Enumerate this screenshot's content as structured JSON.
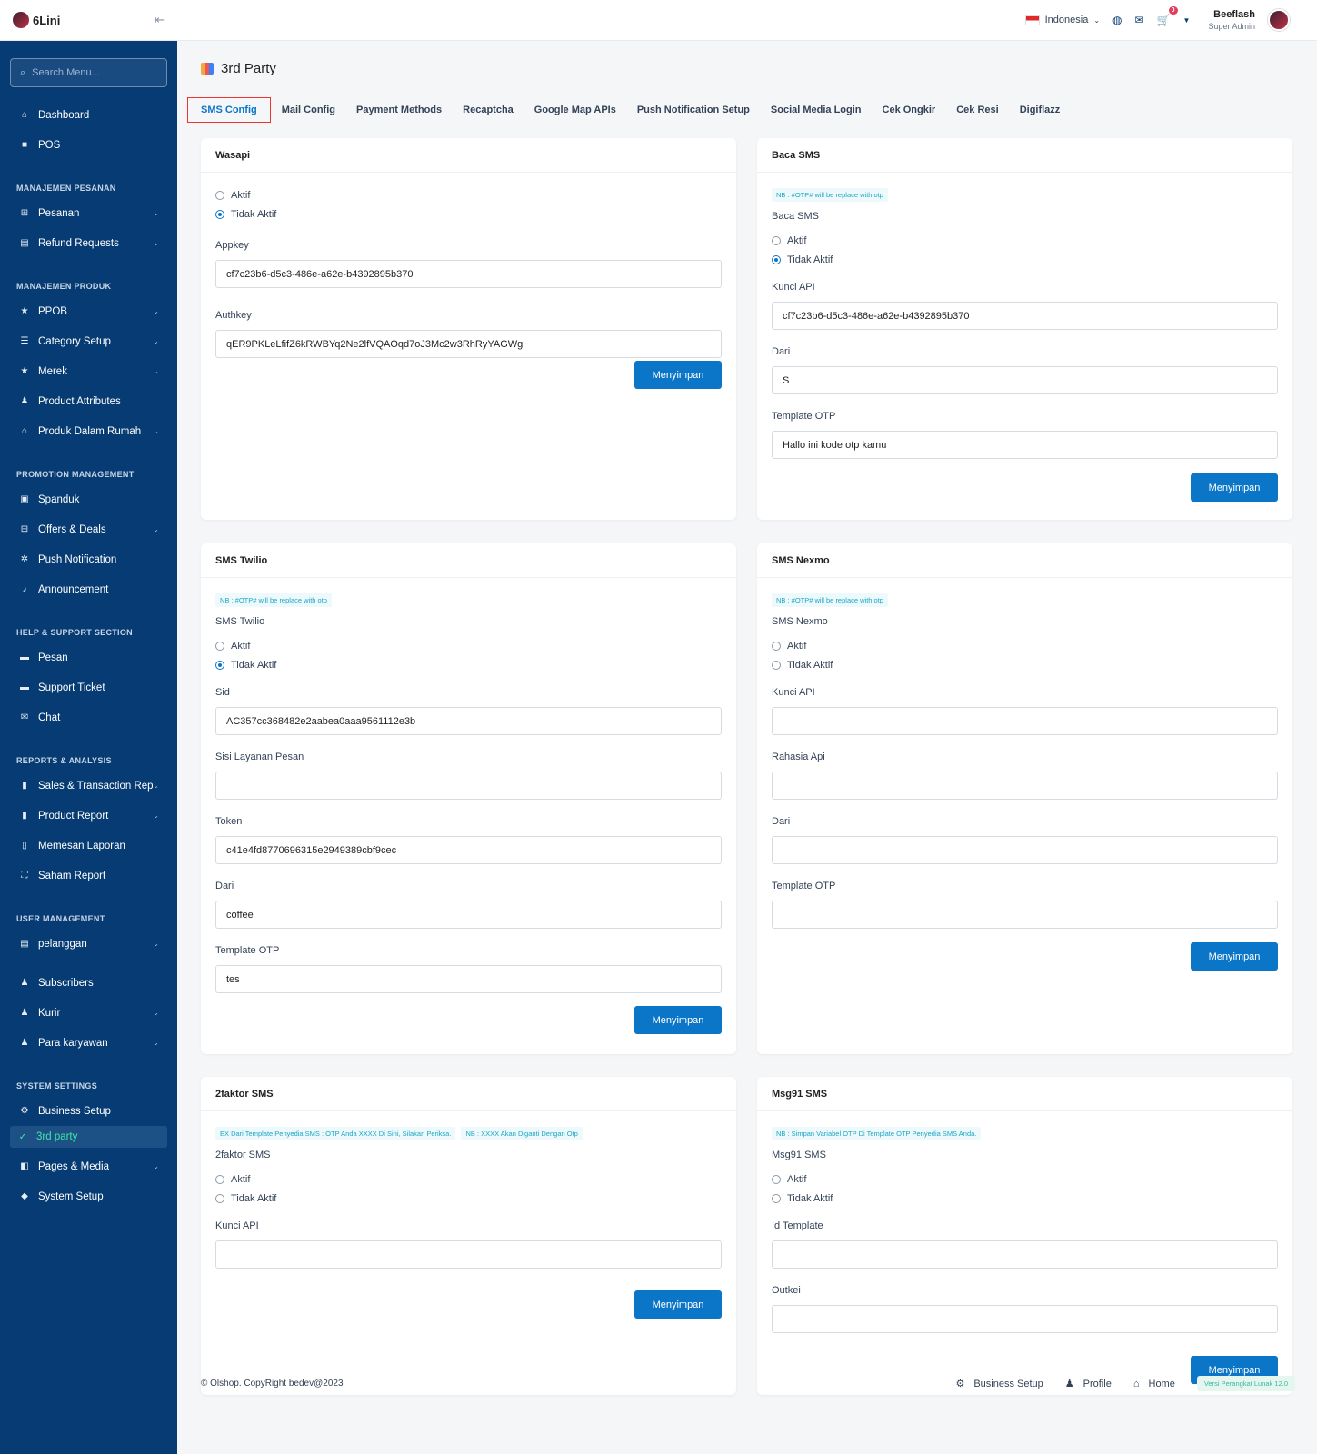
{
  "brand": {
    "name": "6Lini",
    "collapse_icon": "collapse-icon"
  },
  "search": {
    "placeholder": "Search Menu..."
  },
  "sidebar": {
    "top": [
      {
        "label": "Dashboard",
        "icon": "home-icon"
      },
      {
        "label": "POS",
        "icon": "bag-icon"
      }
    ],
    "sections": [
      {
        "title": "MANAJEMEN PESANAN",
        "items": [
          {
            "label": "Pesanan",
            "chev": true
          },
          {
            "label": "Refund Requests",
            "chev": true
          }
        ]
      },
      {
        "title": "MANAJEMEN PRODUK",
        "items": [
          {
            "label": "PPOB",
            "chev": true
          },
          {
            "label": "Category Setup",
            "chev": true
          },
          {
            "label": "Merek",
            "chev": true
          },
          {
            "label": "Product Attributes",
            "chev": false
          },
          {
            "label": "Produk Dalam Rumah",
            "chev": true
          }
        ]
      },
      {
        "title": "PROMOTION MANAGEMENT",
        "items": [
          {
            "label": "Spanduk",
            "chev": false
          },
          {
            "label": "Offers & Deals",
            "chev": true
          },
          {
            "label": "Push Notification",
            "chev": false
          },
          {
            "label": "Announcement",
            "chev": false
          }
        ]
      },
      {
        "title": "HELP & SUPPORT SECTION",
        "items": [
          {
            "label": "Pesan",
            "chev": false
          },
          {
            "label": "Support Ticket",
            "chev": false
          },
          {
            "label": "Chat",
            "chev": false
          }
        ]
      },
      {
        "title": "REPORTS & ANALYSIS",
        "items": [
          {
            "label": "Sales & Transaction Repo",
            "chev": true
          },
          {
            "label": "Product Report",
            "chev": true
          },
          {
            "label": "Memesan Laporan",
            "chev": false
          },
          {
            "label": "Saham Report",
            "chev": false
          }
        ]
      },
      {
        "title": "USER MANAGEMENT",
        "items": [
          {
            "label": "pelanggan",
            "chev": true
          },
          {
            "label": "Subscribers",
            "chev": false
          },
          {
            "label": "Kurir",
            "chev": true
          },
          {
            "label": "Para karyawan",
            "chev": true
          }
        ]
      },
      {
        "title": "SYSTEM SETTINGS",
        "items": [
          {
            "label": "Business Setup",
            "chev": false
          },
          {
            "label": "3rd party",
            "chev": false,
            "active": true
          },
          {
            "label": "Pages & Media",
            "chev": true
          },
          {
            "label": "System Setup",
            "chev": false
          }
        ]
      }
    ]
  },
  "header": {
    "language": "Indonesia",
    "cart_count": "0",
    "user_name": "Beeflash",
    "user_role": "Super Admin"
  },
  "page": {
    "title": "3rd Party"
  },
  "tabs": [
    "SMS Config",
    "Mail Config",
    "Payment Methods",
    "Recaptcha",
    "Google Map APIs",
    "Push Notification Setup",
    "Social Media Login",
    "Cek Ongkir",
    "Cek Resi",
    "Digiflazz"
  ],
  "labels": {
    "aktif": "Aktif",
    "tidak_aktif": "Tidak Aktif",
    "save": "Menyimpan"
  },
  "wasapi": {
    "title": "Wasapi",
    "appkey_label": "Appkey",
    "appkey": "cf7c23b6-d5c3-486e-a62e-b4392895b370",
    "authkey_label": "Authkey",
    "authkey": "qER9PKLeLfifZ6kRWBYq2Ne2lfVQAOqd7oJ3Mc2w3RhRyYAGWg"
  },
  "baca": {
    "title": "Baca SMS",
    "nb": "NB : #OTP# will be replace with otp",
    "label": "Baca SMS",
    "api_label": "Kunci API",
    "api": "cf7c23b6-d5c3-486e-a62e-b4392895b370",
    "from_label": "Dari",
    "from": "S",
    "tpl_label": "Template OTP",
    "tpl": "Hallo ini kode otp kamu"
  },
  "twilio": {
    "title": "SMS Twilio",
    "nb": "NB : #OTP# will be replace with otp",
    "label": "SMS Twilio",
    "sid_label": "Sid",
    "sid": "AC357cc368482e2aabea0aaa9561112e3b",
    "msg_label": "Sisi Layanan Pesan",
    "msg": "",
    "token_label": "Token",
    "token": "c41e4fd8770696315e2949389cbf9cec",
    "from_label": "Dari",
    "from": "coffee",
    "tpl_label": "Template OTP",
    "tpl": "tes"
  },
  "nexmo": {
    "title": "SMS Nexmo",
    "nb": "NB : #OTP# will be replace with otp",
    "label": "SMS Nexmo",
    "api_label": "Kunci API",
    "secret_label": "Rahasia Api",
    "from_label": "Dari",
    "tpl_label": "Template OTP"
  },
  "twofactor": {
    "title": "2faktor SMS",
    "nb1": "EX Dari Template Penyedia SMS : OTP Anda XXXX Di Sini, Silakan Periksa.",
    "nb2": "NB : XXXX Akan Diganti Dengan Otp",
    "label": "2faktor SMS",
    "api_label": "Kunci API"
  },
  "msg91": {
    "title": "Msg91 SMS",
    "nb": "NB : Simpan Variabel OTP Di Template OTP Penyedia SMS Anda.",
    "label": "Msg91 SMS",
    "tpl_label": "Id Template",
    "auth_label": "Outkei"
  },
  "footer": {
    "copyright": "© Olshop. CopyRight bedev@2023",
    "links": [
      "Business Setup",
      "Profile",
      "Home"
    ],
    "version": "Versi Perangkat Lunak 12.0"
  }
}
